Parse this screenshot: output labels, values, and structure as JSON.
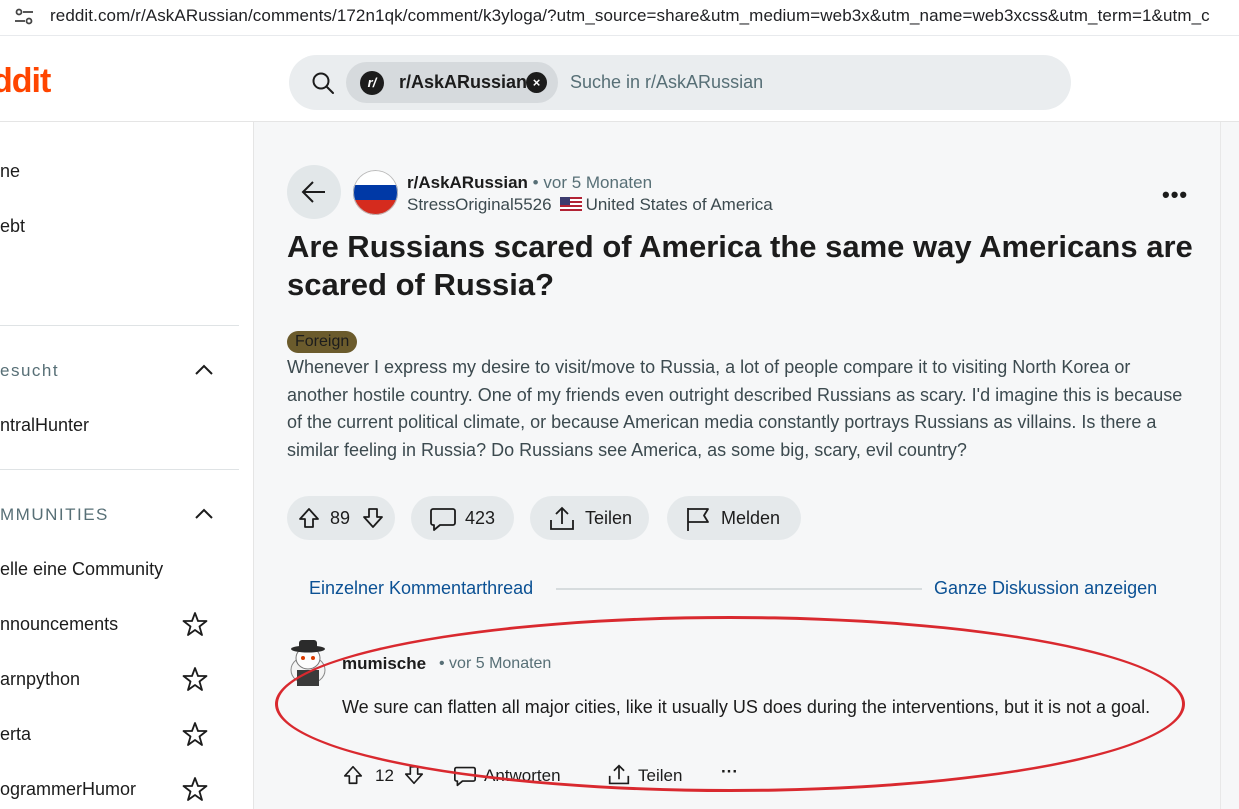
{
  "browser": {
    "url": "reddit.com/r/AskARussian/comments/172n1qk/comment/k3yloga/?utm_source=share&utm_medium=web3x&utm_name=web3xcss&utm_term=1&utm_c"
  },
  "header": {
    "logo": "ddit",
    "search_chip": "r/AskARussian",
    "search_chip_icon": "r/",
    "search_placeholder": "Suche in r/AskARussian"
  },
  "sidebar": {
    "items": [
      "ne",
      "ebt"
    ],
    "recent_header": "esucht",
    "recent_items": [
      "ntralHunter"
    ],
    "communities_header": "MMUNITIES",
    "create_community": "elle eine Community",
    "communities": [
      "nnouncements",
      "arnpython",
      "erta",
      "ogrammerHumor"
    ]
  },
  "post": {
    "subreddit": "r/AskARussian",
    "separator": "•",
    "time": "vor 5 Monaten",
    "author": "StressOriginal5526",
    "author_flair": "United States of America",
    "title": "Are Russians scared of America the same way Americans are scared of Russia?",
    "flair": "Foreign",
    "body": "Whenever I express my desire to visit/move to Russia, a lot of people compare it to visiting North Korea or another hostile country. One of my friends even outright described Russians as scary. I'd imagine this is because of the current political climate, or because American media constantly portrays Russians as villains. Is there a similar feeling in Russia? Do Russians see America, as some big, scary, evil country?",
    "votes": "89",
    "comments": "423",
    "share_label": "Teilen",
    "report_label": "Melden"
  },
  "thread": {
    "single_thread_label": "Einzelner Kommentarthread",
    "full_discussion_label": "Ganze Diskussion anzeigen"
  },
  "comment": {
    "author": "mumische",
    "time": "• vor 5 Monaten",
    "body": "We sure can flatten all major cities, like it usually US does during the interventions, but it is not a goal.",
    "votes": "12",
    "reply_label": "Antworten",
    "share_label": "Teilen"
  },
  "colors": {
    "accent": "#ff4500",
    "link": "#0b5194",
    "highlight": "#d9292f",
    "flair_bg": "#6b5b2c"
  }
}
